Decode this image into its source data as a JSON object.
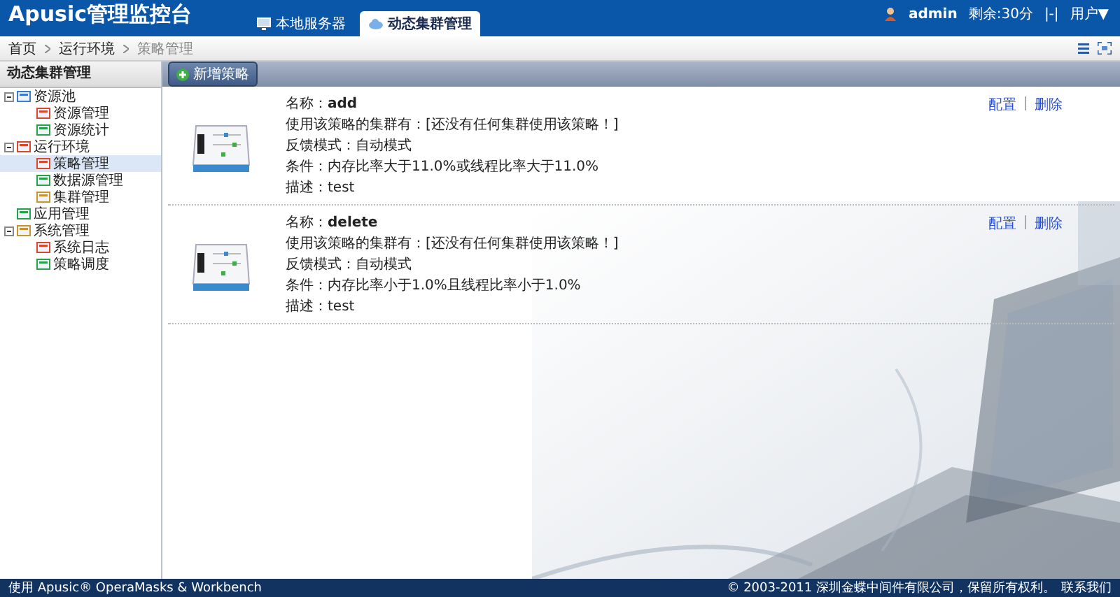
{
  "header": {
    "logo": "Apusic管理监控台",
    "tabs": [
      {
        "label": "本地服务器",
        "selected": false
      },
      {
        "label": "动态集群管理",
        "selected": true
      }
    ],
    "user": "admin",
    "remaining": "剩余:30分",
    "separator": "|-|",
    "menu": "用户▼"
  },
  "breadcrumb": [
    {
      "label": "首页",
      "current": false
    },
    {
      "label": "运行环境",
      "current": false
    },
    {
      "label": "策略管理",
      "current": true
    }
  ],
  "sidebar": {
    "title": "动态集群管理",
    "items": [
      {
        "label": "资源池",
        "expanded": true,
        "selected": false,
        "children": [
          {
            "label": "资源管理",
            "selected": false
          },
          {
            "label": "资源统计",
            "selected": false
          }
        ]
      },
      {
        "label": "运行环境",
        "expanded": true,
        "selected": false,
        "children": [
          {
            "label": "策略管理",
            "selected": true
          },
          {
            "label": "数据源管理",
            "selected": false
          },
          {
            "label": "集群管理",
            "selected": false
          }
        ]
      },
      {
        "label": "应用管理",
        "selected": false
      },
      {
        "label": "系统管理",
        "expanded": true,
        "selected": false,
        "children": [
          {
            "label": "系统日志",
            "selected": false
          },
          {
            "label": "策略调度",
            "selected": false
          }
        ]
      }
    ]
  },
  "toolbar": {
    "add_button": "新增策略"
  },
  "policies": [
    {
      "name_label": "名称：",
      "name": "add",
      "fields": [
        {
          "label": "使用该策略的集群有：",
          "value": "[还没有任何集群使用该策略！]"
        },
        {
          "label": "反馈模式：",
          "value": "自动模式"
        },
        {
          "label": "条件：",
          "value": "内存比率大于11.0%或线程比率大于11.0%"
        },
        {
          "label": "描述：",
          "value": "test"
        }
      ],
      "actions": [
        "配置",
        "删除"
      ]
    },
    {
      "name_label": "名称：",
      "name": "delete",
      "fields": [
        {
          "label": "使用该策略的集群有：",
          "value": "[还没有任何集群使用该策略！]"
        },
        {
          "label": "反馈模式：",
          "value": "自动模式"
        },
        {
          "label": "条件：",
          "value": "内存比率小于1.0%且线程比率小于1.0%"
        },
        {
          "label": "描述：",
          "value": "test"
        }
      ],
      "actions": [
        "配置",
        "删除"
      ]
    }
  ],
  "footer": {
    "left": "使用 Apusic® OperaMasks & Workbench",
    "right": "© 2003-2011 深圳金蝶中间件有限公司，保留所有权利。",
    "contact": "联系我们"
  }
}
